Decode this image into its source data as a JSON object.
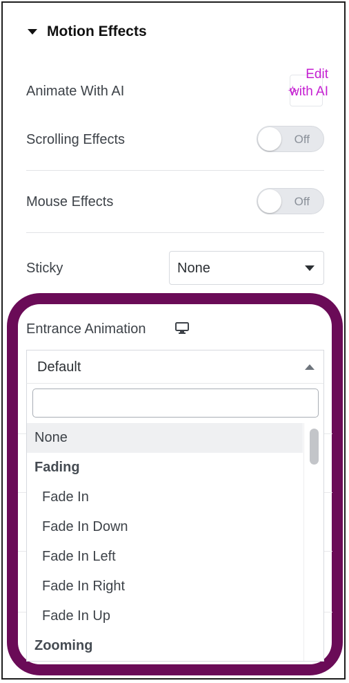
{
  "section": {
    "title": "Motion Effects"
  },
  "animate_ai": {
    "label": "Animate With AI",
    "button_label": "Edit with AI"
  },
  "scrolling_effects": {
    "label": "Scrolling Effects",
    "toggle_text": "Off"
  },
  "mouse_effects": {
    "label": "Mouse Effects",
    "toggle_text": "Off"
  },
  "sticky": {
    "label": "Sticky",
    "value": "None"
  },
  "entrance_animation": {
    "label": "Entrance Animation",
    "selected": "Default",
    "search_placeholder": "",
    "options": [
      {
        "label": "None",
        "kind": "option",
        "selected": true
      },
      {
        "label": "Fading",
        "kind": "group"
      },
      {
        "label": "Fade In",
        "kind": "sub"
      },
      {
        "label": "Fade In Down",
        "kind": "sub"
      },
      {
        "label": "Fade In Left",
        "kind": "sub"
      },
      {
        "label": "Fade In Right",
        "kind": "sub"
      },
      {
        "label": "Fade In Up",
        "kind": "sub"
      },
      {
        "label": "Zooming",
        "kind": "group"
      }
    ]
  },
  "colors": {
    "ai_accent": "#c41ed1",
    "highlight": "#6a0b57",
    "toggle_off_bg": "#e6e8ec"
  }
}
